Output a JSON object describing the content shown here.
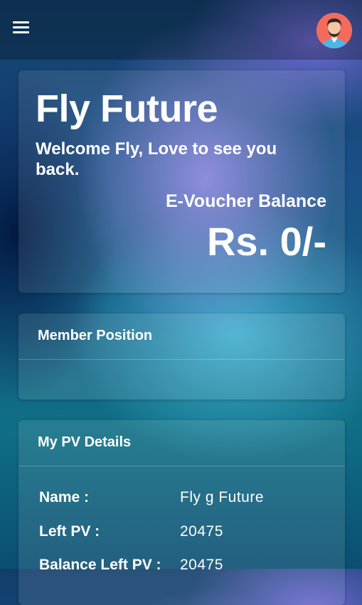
{
  "header": {
    "menu_icon": "hamburger-menu-icon",
    "avatar_icon": "user-avatar-icon"
  },
  "hero": {
    "title": "Fly Future",
    "welcome": "Welcome Fly, Love to see you back.",
    "balance_label": "E-Voucher Balance",
    "balance_value": "Rs. 0/-"
  },
  "member_position": {
    "title": "Member Position"
  },
  "pv_details": {
    "title": "My PV Details",
    "rows": [
      {
        "label": "Name :",
        "value": "Fly g Future"
      },
      {
        "label": "Left PV :",
        "value": "20475"
      },
      {
        "label": "Balance Left PV :",
        "value": "20475"
      }
    ]
  },
  "colors": {
    "avatar_bg": "#f46b5c",
    "text": "#ffffff"
  }
}
